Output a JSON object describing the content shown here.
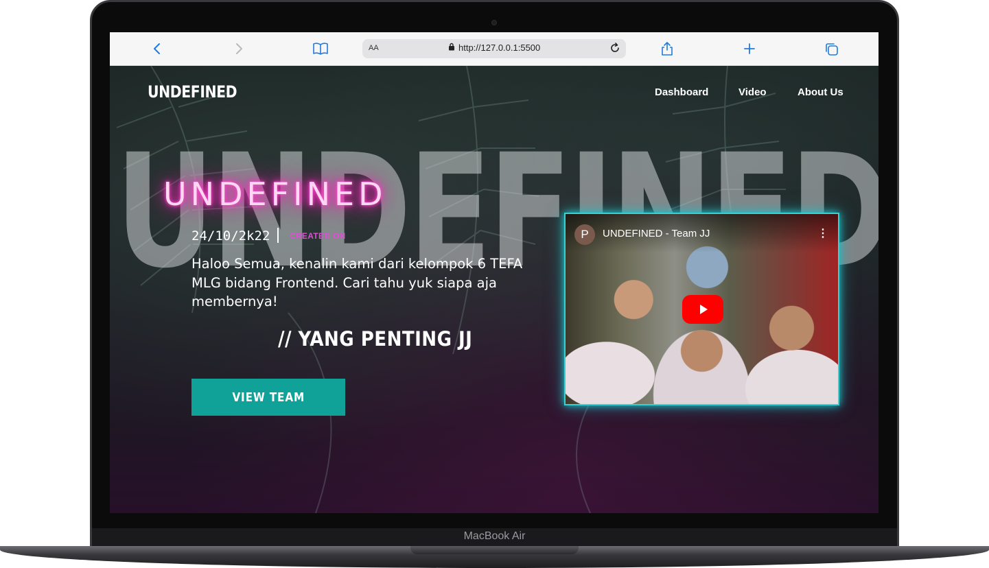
{
  "device": {
    "model_label": "MacBook Air"
  },
  "browser": {
    "text_size_label": "AA",
    "url": "http://127.0.0.1:5500"
  },
  "site": {
    "brand": "UNDEFINED",
    "nav": [
      "Dashboard",
      "Video",
      "About Us"
    ],
    "background_word": "UNDEFINED",
    "hero": {
      "neon_title": "UNDEFINED",
      "date": "24/10/2k22",
      "created_label": "CREATED ON",
      "description": "Haloo Semua, kenalin kami dari kelompok 6 TEFA MLG bidang Frontend. Cari tahu yuk siapa aja membernya!",
      "slogan": "// YANG PENTING JJ",
      "button_label": "VIEW TEAM"
    },
    "video": {
      "channel_initial": "P",
      "title": "UNDEFINED - Team JJ",
      "menu": "⋮"
    }
  },
  "colors": {
    "accent_teal": "#10a199",
    "neon_pink": "#ff2ec4",
    "created_pink": "#e24bd6",
    "video_glow": "#32d2d6",
    "browser_icon_blue": "#1f7ae0"
  },
  "icons": [
    "back-icon",
    "forward-icon",
    "bookmarks-icon",
    "lock-icon",
    "reload-icon",
    "share-icon",
    "new-tab-icon",
    "tabs-icon",
    "play-icon",
    "more-vert-icon"
  ]
}
